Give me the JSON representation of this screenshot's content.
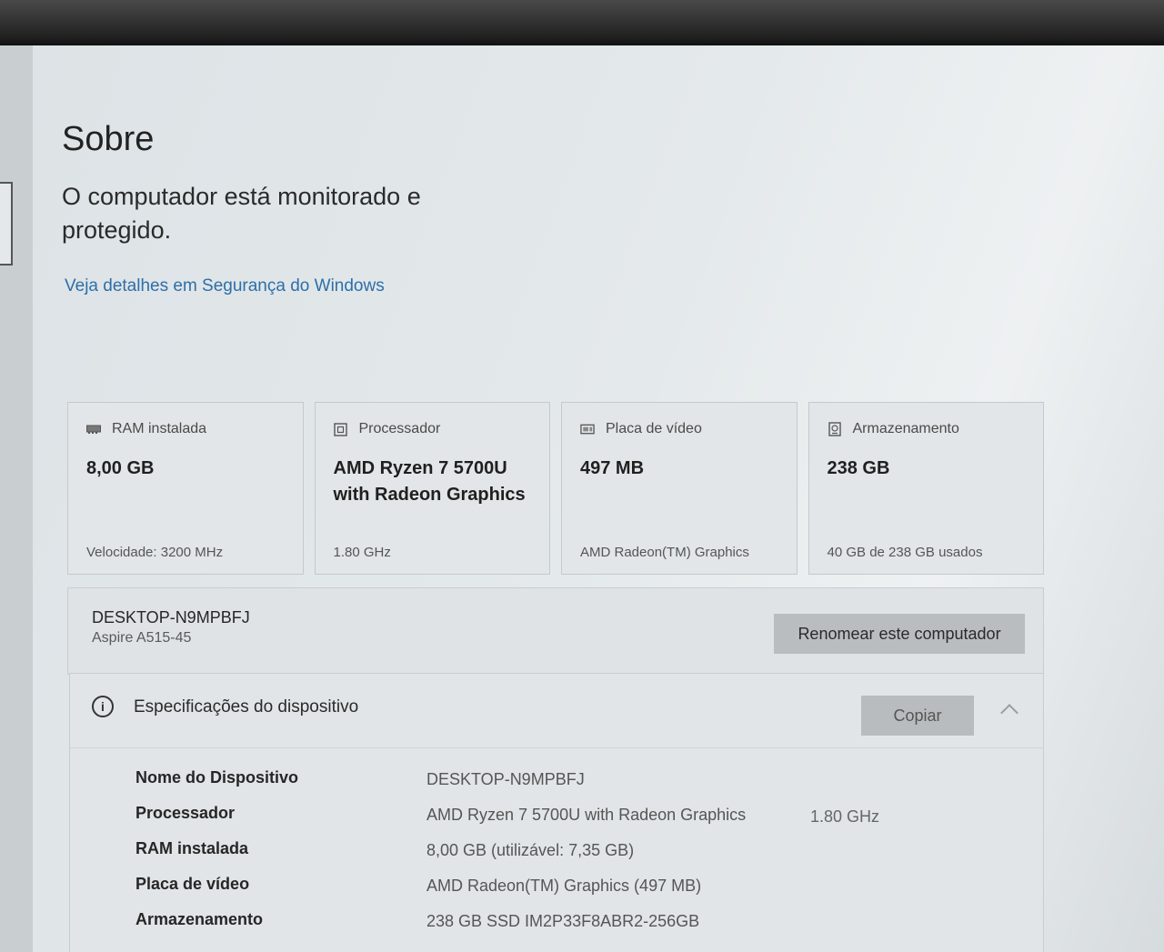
{
  "page": {
    "title": "Sobre",
    "protection_status": "O computador está monitorado e protegido.",
    "security_link": "Veja detalhes em Segurança do Windows"
  },
  "cards": [
    {
      "icon": "ram-icon",
      "label": "RAM instalada",
      "value": "8,00 GB",
      "sub": "Velocidade: 3200 MHz"
    },
    {
      "icon": "processor-icon",
      "label": "Processador",
      "value": "AMD Ryzen 7 5700U with Radeon Graphics",
      "sub": "1.80 GHz"
    },
    {
      "icon": "gpu-icon",
      "label": "Placa de vídeo",
      "value": "497 MB",
      "sub": "AMD Radeon(TM) Graphics"
    },
    {
      "icon": "storage-icon",
      "label": "Armazenamento",
      "value": "238 GB",
      "sub": "40 GB de 238 GB usados"
    }
  ],
  "device": {
    "name": "DESKTOP-N9MPBFJ",
    "model": "Aspire A515-45",
    "rename_label": "Renomear este computador"
  },
  "specs": {
    "title": "Especificações do dispositivo",
    "copy_label": "Copiar",
    "rows": [
      {
        "key": "Nome do Dispositivo",
        "value": "DESKTOP-N9MPBFJ",
        "extra": ""
      },
      {
        "key": "Processador",
        "value": "AMD Ryzen 7 5700U with Radeon Graphics",
        "extra": "1.80 GHz"
      },
      {
        "key": "RAM instalada",
        "value": "8,00 GB (utilizável: 7,35 GB)",
        "extra": ""
      },
      {
        "key": "Placa de vídeo",
        "value": "AMD Radeon(TM) Graphics (497 MB)",
        "extra": ""
      },
      {
        "key": "Armazenamento",
        "value": "238 GB SSD IM2P33F8ABR2-256GB",
        "extra": ""
      }
    ]
  },
  "colors": {
    "accent_link": "#2d6fa8",
    "button_bg": "#b9bdbf"
  }
}
